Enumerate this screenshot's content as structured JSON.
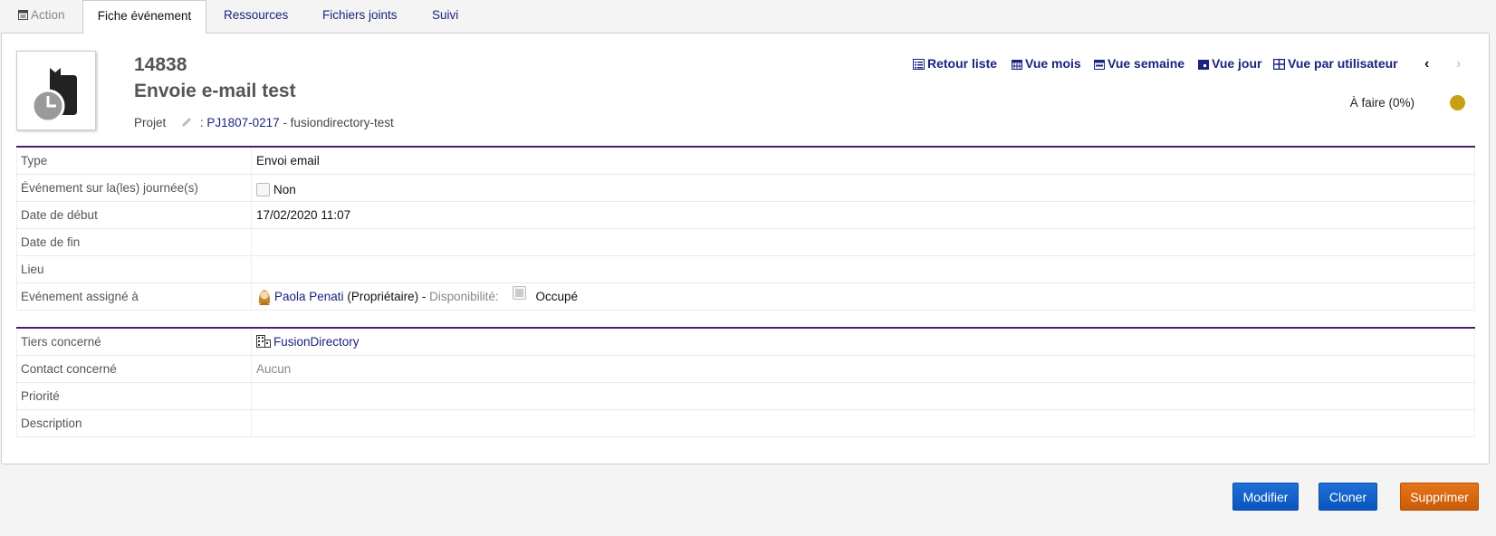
{
  "tabs": [
    {
      "label": "Action",
      "icon": "calendar-icon"
    },
    {
      "label": "Fiche événement"
    },
    {
      "label": "Ressources"
    },
    {
      "label": "Fichiers joints"
    },
    {
      "label": "Suivi"
    }
  ],
  "event": {
    "ref": "14838",
    "title": "Envoie e-mail test",
    "project_label": "Projet",
    "project_sep": ":",
    "project_ref": "PJ1807-0217",
    "project_name": "- fusiondirectory-test",
    "status": "À faire (0%)",
    "status_color": "#c9a013"
  },
  "nav": {
    "back_list": "Retour liste",
    "month": "Vue mois",
    "week": "Vue semaine",
    "day": "Vue jour",
    "per_user": "Vue par utilisateur",
    "prev": "‹",
    "next": "›"
  },
  "fields": {
    "type_label": "Type",
    "type_value": "Envoi email",
    "allday_label": "Événement sur la(les) journée(s)",
    "allday_value": "Non",
    "start_label": "Date de début",
    "start_value": "17/02/2020 11:07",
    "end_label": "Date de fin",
    "end_value": "",
    "place_label": "Lieu",
    "place_value": "",
    "assigned_label": "Evénement assigné à",
    "assigned_user": "Paola Penati",
    "assigned_role": "(Propriétaire) -",
    "availability_label": "Disponibilité:",
    "availability_value": "Occupé"
  },
  "fields2": {
    "thirdparty_label": "Tiers concerné",
    "thirdparty_value": "FusionDirectory",
    "contact_label": "Contact concerné",
    "contact_value": "Aucun",
    "priority_label": "Priorité",
    "priority_value": "",
    "description_label": "Description",
    "description_value": ""
  },
  "buttons": {
    "modify": "Modifier",
    "clone": "Cloner",
    "delete": "Supprimer"
  },
  "colors": {
    "accent": "#4b1d6e",
    "link": "#1a237e",
    "primary_button": "#0a55bf",
    "danger_button": "#c95c08"
  }
}
